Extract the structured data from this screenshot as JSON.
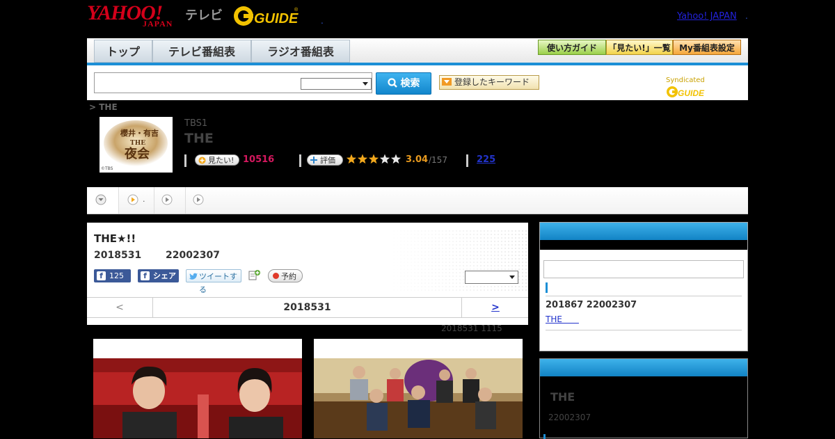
{
  "header": {
    "logo_yahoo": "YAHOO!",
    "logo_japan": "JAPAN",
    "logo_tv": "テレビ",
    "logo_gguide": "G GUIDE",
    "yahoo_japan_link": "Yahoo! JAPAN",
    "dot": "."
  },
  "nav": {
    "tabs": [
      {
        "label": "トップ"
      },
      {
        "label": "テレビ番組表"
      },
      {
        "label": "ラジオ番組表"
      }
    ],
    "buttons": [
      {
        "label": "使い方ガイド"
      },
      {
        "label": "「見たい!」一覧"
      },
      {
        "label": "My番組表設定"
      }
    ]
  },
  "search": {
    "button_label": "検索",
    "keyword_button": "登録したキーワード",
    "syndicated": "Syndicated",
    "syndicated_logo": "G GUIDE"
  },
  "breadcrumb": "> THE",
  "program": {
    "thumb_text": "櫻井・有吉 THE 夜会",
    "thumb_credit": "©TBS",
    "channel": "TBS1",
    "title": "THE",
    "mitai_label": "見たい!",
    "mitai_count": "10516",
    "rating_label": "評価",
    "rating_stars": 3,
    "rating_max": 5,
    "rating_score": "3.04",
    "rating_total": "/157",
    "comment_count": "225"
  },
  "tabs_strip": {
    "dot": "."
  },
  "main": {
    "title": "THE★!!",
    "date": "2018531",
    "time": "22002307",
    "fb_count": "125",
    "share_label": "シェア",
    "tweet_label": "ツイートする",
    "reserve_label": "予約",
    "pager_prev": "<",
    "pager_current": "2018531",
    "pager_next": ">",
    "updated": "2018531  1115"
  },
  "sidebar": {
    "box1": {
      "date": "201867  22002307",
      "link": "THE　　"
    },
    "box2": {
      "title": "THE",
      "time": "22002307"
    }
  },
  "colors": {
    "accent_blue": "#1c8fd6",
    "yahoo_red": "#d4001a",
    "mitai_pink": "#d6185f",
    "rating_orange": "#e89a1f"
  }
}
